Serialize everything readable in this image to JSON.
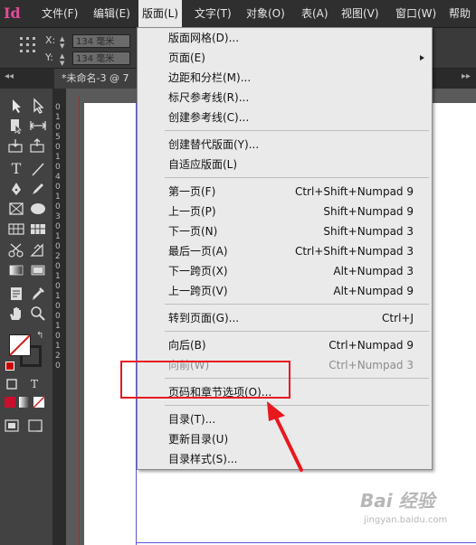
{
  "menubar": {
    "logo": "Id",
    "items": [
      {
        "label": "文件(F)"
      },
      {
        "label": "编辑(E)"
      },
      {
        "label": "版面(L)"
      },
      {
        "label": "文字(T)"
      },
      {
        "label": "对象(O)"
      },
      {
        "label": "表(A)"
      },
      {
        "label": "视图(V)"
      },
      {
        "label": "窗口(W)"
      },
      {
        "label": "帮助"
      }
    ]
  },
  "controlbar": {
    "x_label": "X:",
    "y_label": "Y:",
    "x_value": "134 毫米",
    "y_value": "134 毫米"
  },
  "tabs": {
    "collapse": "◂◂",
    "doc_tab": "*未命名-3 @ 7",
    "right": "▸▸"
  },
  "ruler": {
    "ticks": [
      "0",
      "1",
      "0",
      "5",
      "0",
      "1",
      "0",
      "4",
      "0",
      "1",
      "0",
      "3",
      "0",
      "1",
      "0",
      "2",
      "0",
      "1",
      "0",
      "1",
      "0",
      "0",
      "1",
      "0",
      "1",
      "2",
      "0"
    ]
  },
  "dropdown": {
    "items": [
      {
        "label": "版面网格(D)...",
        "shortcut": ""
      },
      {
        "label": "页面(E)",
        "shortcut": ""
      },
      {
        "label": "边距和分栏(M)...",
        "shortcut": ""
      },
      {
        "label": "标尺参考线(R)...",
        "shortcut": ""
      },
      {
        "label": "创建参考线(C)...",
        "shortcut": ""
      },
      {
        "label": "创建替代版面(Y)...",
        "shortcut": ""
      },
      {
        "label": "自适应版面(L)",
        "shortcut": ""
      },
      {
        "label": "第一页(F)",
        "shortcut": "Ctrl+Shift+Numpad 9"
      },
      {
        "label": "上一页(P)",
        "shortcut": "Shift+Numpad 9"
      },
      {
        "label": "下一页(N)",
        "shortcut": "Shift+Numpad 3"
      },
      {
        "label": "最后一页(A)",
        "shortcut": "Ctrl+Shift+Numpad 3"
      },
      {
        "label": "下一跨页(X)",
        "shortcut": "Alt+Numpad 3"
      },
      {
        "label": "上一跨页(V)",
        "shortcut": "Alt+Numpad 9"
      },
      {
        "label": "转到页面(G)...",
        "shortcut": "Ctrl+J"
      },
      {
        "label": "向后(B)",
        "shortcut": "Ctrl+Numpad 9"
      },
      {
        "label": "向前(W)",
        "shortcut": "Ctrl+Numpad 3"
      },
      {
        "label": "页码和章节选项(O)...",
        "shortcut": ""
      },
      {
        "label": "目录(T)...",
        "shortcut": ""
      },
      {
        "label": "更新目录(U)",
        "shortcut": ""
      },
      {
        "label": "目录样式(S)...",
        "shortcut": ""
      }
    ]
  },
  "tools": {
    "type_tool": "T",
    "frame_text": "T"
  },
  "watermark": {
    "logo": "Bai 经验",
    "url": "jingyan.baidu.com"
  },
  "colors": {
    "accent_highlight": "#e8181f",
    "page_border": "#5b53d6",
    "menu_bg": "#eaeaea"
  }
}
